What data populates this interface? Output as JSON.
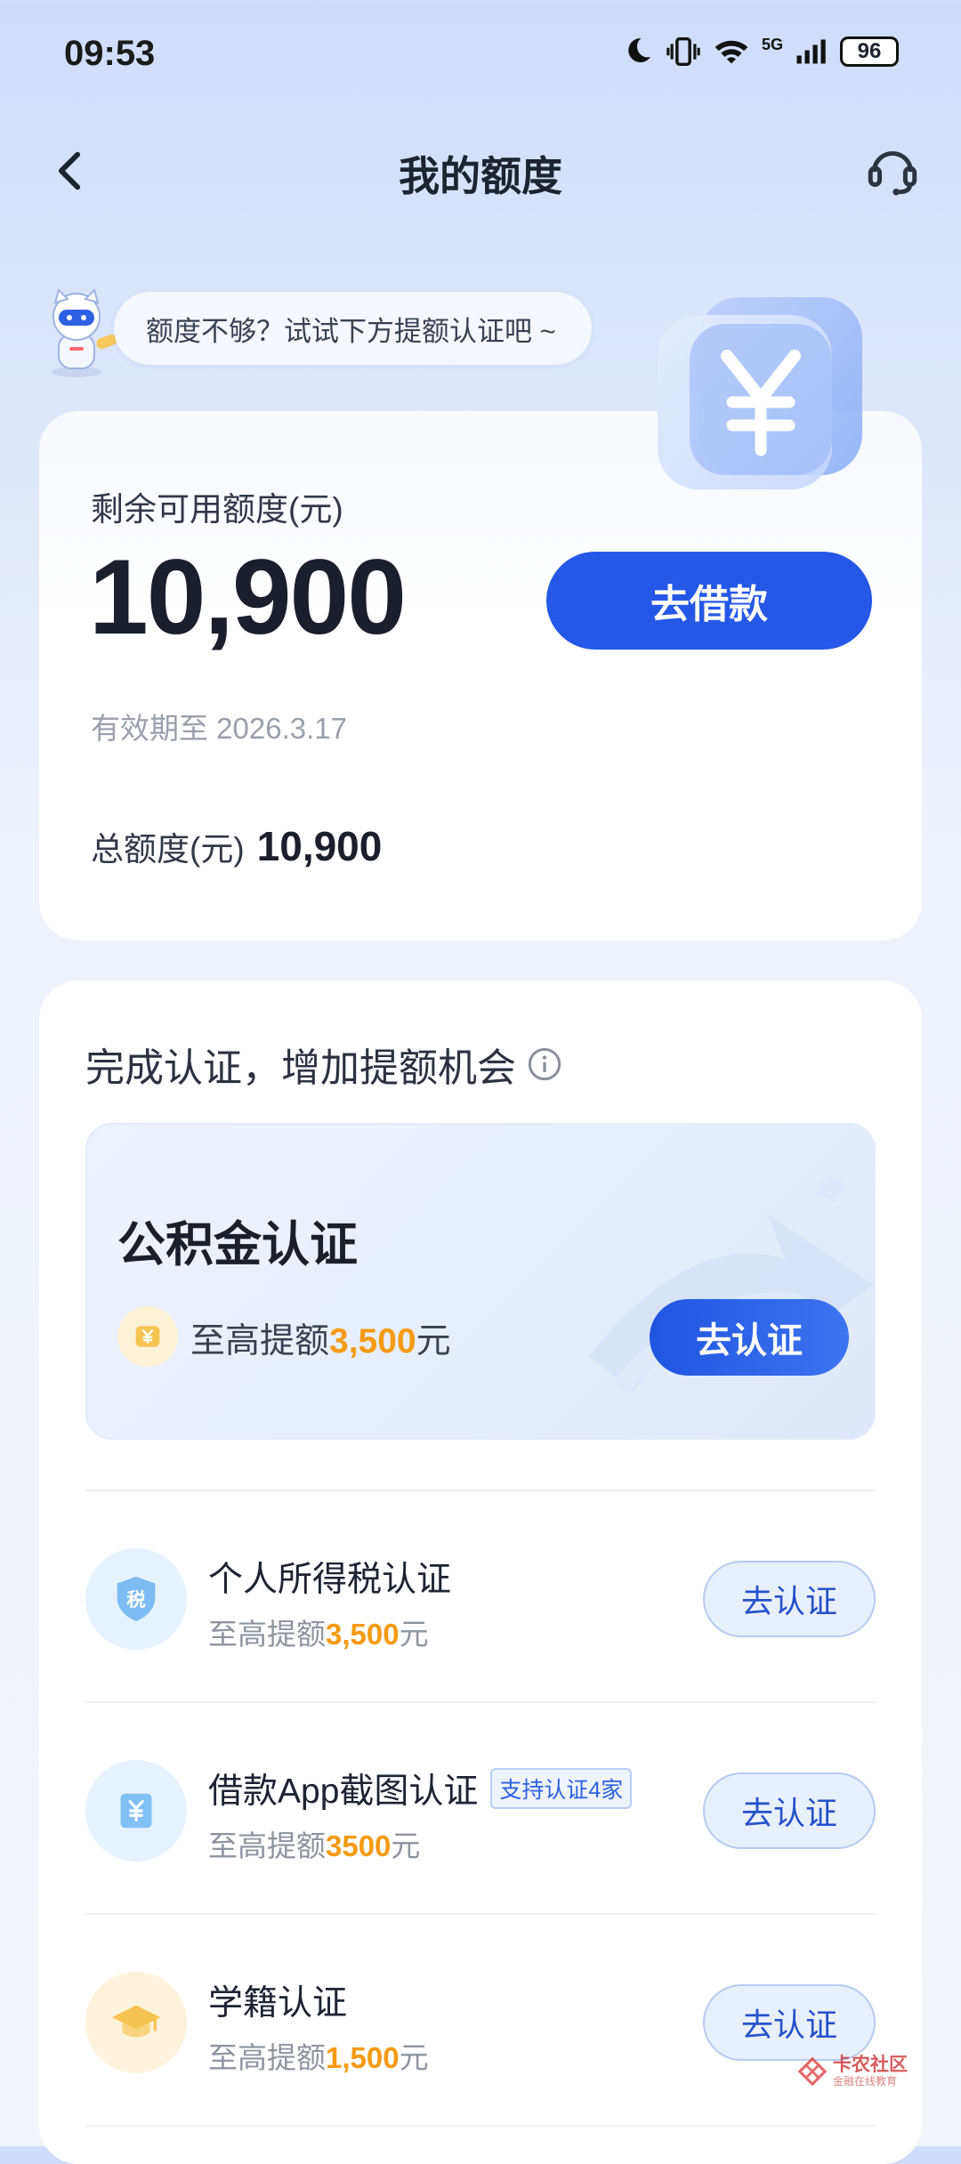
{
  "status_bar": {
    "time": "09:53",
    "network": "5G",
    "battery": "96",
    "icons": [
      "moon-icon",
      "vibrate-icon",
      "wifi-icon",
      "signal-icon",
      "battery-icon"
    ]
  },
  "nav": {
    "title": "我的额度",
    "back_icon": "chevron-left-icon",
    "service_icon": "headset-icon"
  },
  "tip": {
    "text": "额度不够？试试下方提额认证吧 ~"
  },
  "credit": {
    "remaining_label": "剩余可用额度(元)",
    "remaining_amount": "10,900",
    "borrow_button": "去借款",
    "validity": "有效期至 2026.3.17",
    "total_label": "总额度(元)",
    "total_amount": "10,900"
  },
  "certification": {
    "title": "完成认证，增加提额机会",
    "featured": {
      "title": "公积金认证",
      "sub_prefix": "至高提额",
      "sub_amount": "3,500",
      "sub_suffix": "元",
      "button": "去认证"
    },
    "items": [
      {
        "title": "个人所得税认证",
        "tag": "",
        "sub_prefix": "至高提额",
        "sub_amount": "3,500",
        "sub_suffix": "元",
        "button": "去认证",
        "icon": "tax-shield-icon"
      },
      {
        "title": "借款App截图认证",
        "tag": "支持认证4家",
        "sub_prefix": "至高提额",
        "sub_amount": "3500",
        "sub_suffix": "元",
        "button": "去认证",
        "icon": "yen-document-icon"
      },
      {
        "title": "学籍认证",
        "tag": "",
        "sub_prefix": "至高提额",
        "sub_amount": "1,500",
        "sub_suffix": "元",
        "button": "去认证",
        "icon": "graduation-cap-icon"
      }
    ]
  },
  "watermark": {
    "main": "卡农社区",
    "sub": "金融在线教育"
  },
  "colors": {
    "primary_blue": "#2558e6",
    "highlight_orange": "#f59a12"
  }
}
